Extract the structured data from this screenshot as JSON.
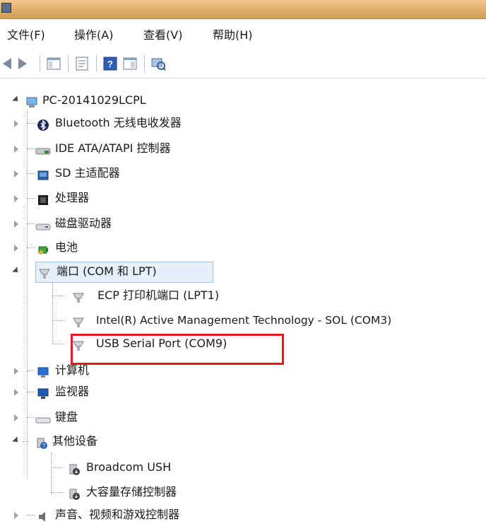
{
  "menu": {
    "file": "文件(F)",
    "action": "操作(A)",
    "view": "查看(V)",
    "help": "帮助(H)"
  },
  "tree": {
    "root": "PC-20141029LCPL",
    "items": [
      {
        "label": "Bluetooth 无线电收发器",
        "icon": "bluetooth-icon"
      },
      {
        "label": "IDE ATA/ATAPI 控制器",
        "icon": "ide-controller-icon"
      },
      {
        "label": "SD 主适配器",
        "icon": "sd-adapter-icon"
      },
      {
        "label": "处理器",
        "icon": "processor-icon"
      },
      {
        "label": "磁盘驱动器",
        "icon": "disk-drive-icon"
      },
      {
        "label": "电池",
        "icon": "battery-icon"
      },
      {
        "label": "端口 (COM 和 LPT)",
        "icon": "port-icon"
      },
      {
        "label": "计算机",
        "icon": "computer-icon"
      },
      {
        "label": "监视器",
        "icon": "monitor-icon"
      },
      {
        "label": "键盘",
        "icon": "keyboard-icon"
      },
      {
        "label": "其他设备",
        "icon": "unknown-device-icon"
      },
      {
        "label": "声音、视频和游戏控制器",
        "icon": "sound-icon"
      }
    ],
    "ports_children": [
      "ECP 打印机端口 (LPT1)",
      "Intel(R) Active Management Technology - SOL (COM3)",
      "USB Serial Port (COM9)"
    ],
    "other_children": [
      "Broadcom USH",
      "大容量存储控制器"
    ]
  },
  "colors": {
    "highlight": "#e31b23",
    "selection_bg": "#e6f0fb"
  }
}
